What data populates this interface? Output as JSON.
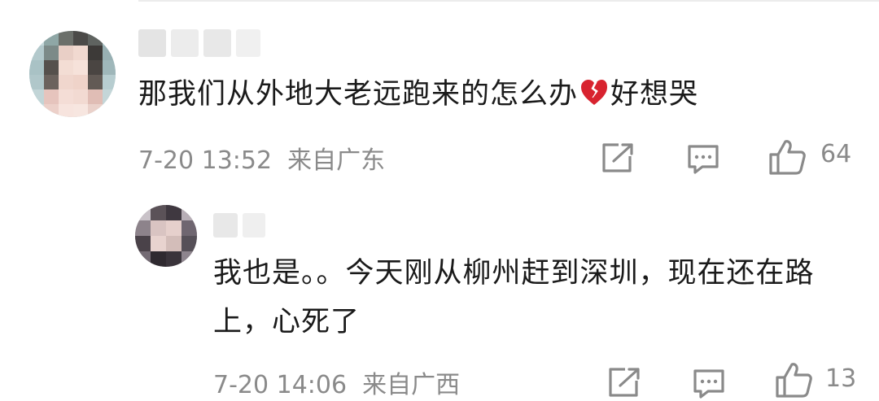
{
  "comments": [
    {
      "text_before_emoji": "那我们从外地大老远跑来的怎么办",
      "emoji": "broken-heart",
      "text_after_emoji": "好想哭",
      "time": "7-20 13:52",
      "location": "来自广东",
      "likes": "64"
    },
    {
      "text": "我也是。。今天刚从柳州赶到深圳，现在还在路上，心死了",
      "time": "7-20 14:06",
      "location": "来自广西",
      "likes": "13"
    }
  ],
  "icons": [
    "share-icon",
    "comment-icon",
    "like-icon",
    "broken-heart-emoji"
  ],
  "colors": {
    "meta_text": "#8a8a8a",
    "body_text": "#1a1a1a",
    "emoji_red": "#d8232f"
  }
}
